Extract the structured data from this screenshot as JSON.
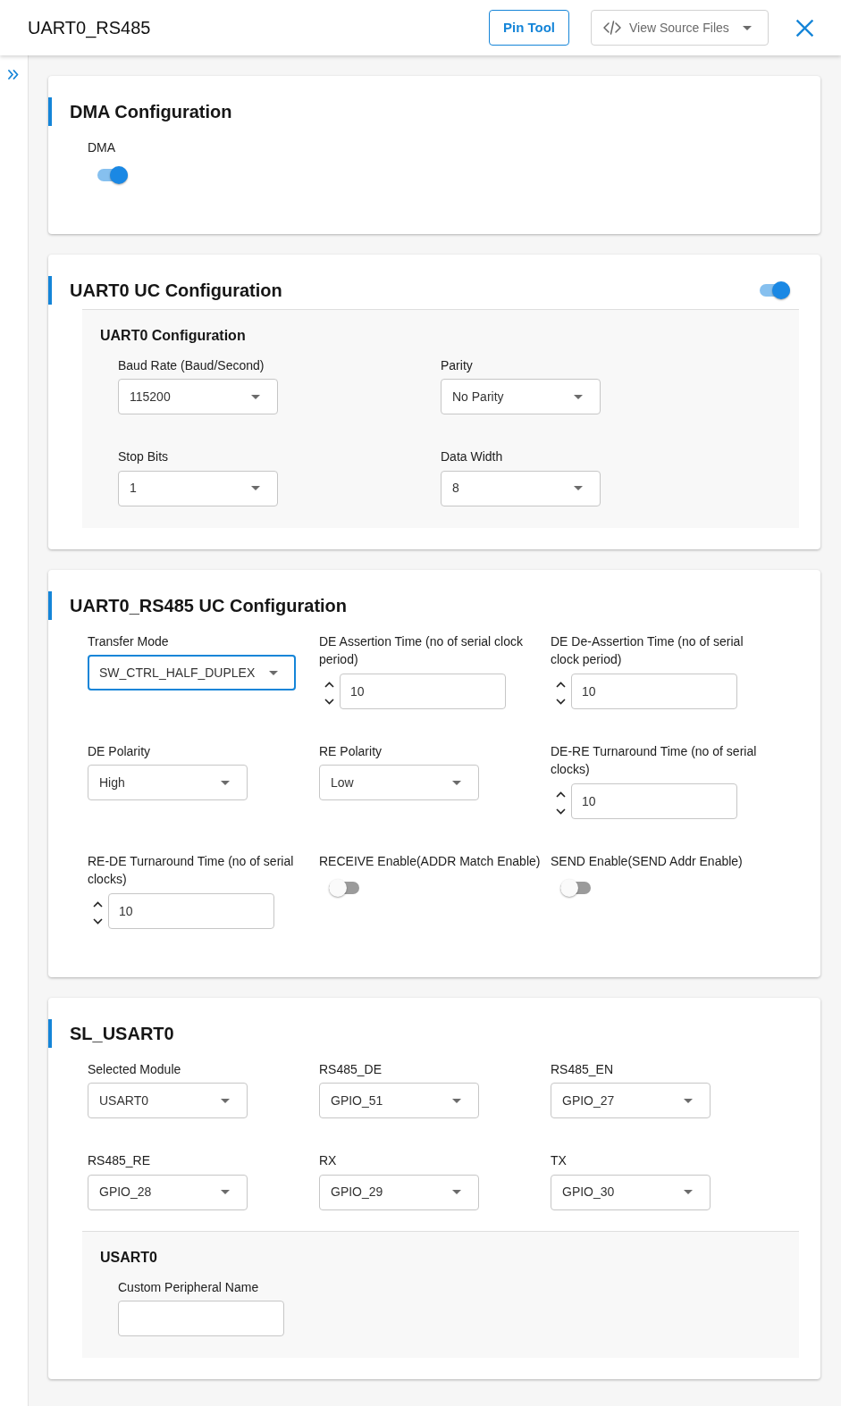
{
  "header": {
    "title": "UART0_RS485",
    "pin_tool_button": "Pin Tool",
    "source_files_menu": "View Source Files"
  },
  "sections": [
    {
      "title": "DMA Configuration",
      "fields": [
        {
          "kind": "switch",
          "label": "DMA",
          "on": true
        }
      ]
    },
    {
      "title": "UART0 UC Configuration",
      "header_switch": {
        "on": true
      },
      "groups": [
        {
          "title": "UART0 Configuration",
          "fields": [
            {
              "kind": "select",
              "label": "Baud Rate (Baud/Second)",
              "value": "115200",
              "focused": false
            },
            {
              "kind": "select",
              "label": "Parity",
              "value": "No Parity",
              "focused": false
            },
            {
              "kind": "select",
              "label": "Stop Bits",
              "value": "1",
              "focused": false
            },
            {
              "kind": "select",
              "label": "Data Width",
              "value": "8",
              "focused": false
            }
          ]
        }
      ]
    },
    {
      "title": "UART0_RS485 UC Configuration",
      "fields": [
        {
          "kind": "select",
          "label": "Transfer Mode",
          "value": "SW_CTRL_HALF_DUPLEX",
          "focused": true
        },
        {
          "kind": "number",
          "label": "DE Assertion Time (no of serial clock period)",
          "value": "10",
          "focused": false
        },
        {
          "kind": "number",
          "label": "DE De-Assertion Time (no of serial clock period)",
          "value": "10",
          "focused": false
        },
        {
          "kind": "select",
          "label": "DE Polarity",
          "value": "High",
          "focused": false
        },
        {
          "kind": "select",
          "label": "RE Polarity",
          "value": "Low",
          "focused": false
        },
        {
          "kind": "number",
          "label": "DE-RE Turnaround Time (no of serial clocks)",
          "value": "10",
          "focused": false
        },
        {
          "kind": "number",
          "label": "RE-DE Turnaround Time (no of serial clocks)",
          "value": "10",
          "focused": false
        },
        {
          "kind": "switch",
          "label": "RECEIVE Enable(ADDR Match Enable)",
          "on": false
        },
        {
          "kind": "switch",
          "label": "SEND Enable(SEND Addr Enable)",
          "on": false
        }
      ]
    },
    {
      "title": "SL_USART0",
      "fields": [
        {
          "kind": "select",
          "label": "Selected Module",
          "value": "USART0",
          "focused": false
        },
        {
          "kind": "select",
          "label": "RS485_DE",
          "value": "GPIO_51",
          "focused": false
        },
        {
          "kind": "select",
          "label": "RS485_EN",
          "value": "GPIO_27",
          "focused": false
        },
        {
          "kind": "select",
          "label": "RS485_RE",
          "value": "GPIO_28",
          "focused": false
        },
        {
          "kind": "select",
          "label": "RX",
          "value": "GPIO_29",
          "focused": false
        },
        {
          "kind": "select",
          "label": "TX",
          "value": "GPIO_30",
          "focused": false
        }
      ],
      "groups": [
        {
          "title": "USART0",
          "fields": [
            {
              "kind": "text",
              "label": "Custom Peripheral Name",
              "focused": false
            }
          ]
        }
      ]
    }
  ]
}
